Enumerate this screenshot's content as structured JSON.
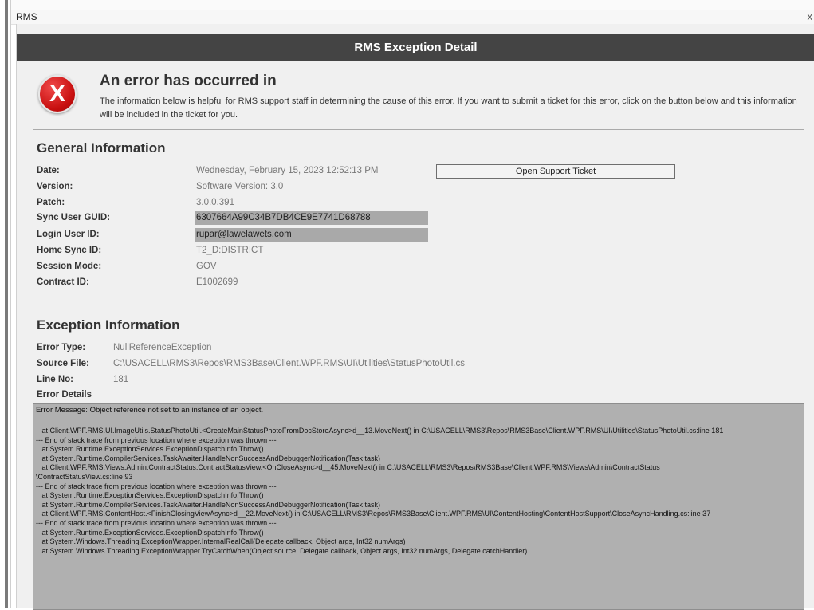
{
  "window": {
    "title": "RMS",
    "close_glyph": "x"
  },
  "dialog": {
    "header": "RMS Exception Detail",
    "error_icon_glyph": "X",
    "error_title": "An error has occurred in",
    "error_description": "The information below is helpful for RMS support staff in determining the cause of this error. If you want to submit a ticket for this error, click on the button below and this information will be included in the ticket for you.",
    "accent_colors": {
      "header_bg": "#444444",
      "error_red": "#c80f0f",
      "highlight_bg": "#a9a9a9"
    }
  },
  "general": {
    "title": "General Information",
    "open_ticket_label": "Open Support Ticket",
    "rows": [
      {
        "label": "Date:",
        "value": "Wednesday, February 15, 2023 12:52:13 PM"
      },
      {
        "label": "Version:",
        "value": "Software Version: 3.0"
      },
      {
        "label": "Patch:",
        "value": "3.0.0.391"
      },
      {
        "label": "Sync User GUID:",
        "value": "6307664A99C34B7DB4CE9E7741D68788"
      },
      {
        "label": "Login User ID:",
        "value": "rupar@lawelawets.com"
      },
      {
        "label": "Home Sync ID:",
        "value": "T2_D:DISTRICT"
      },
      {
        "label": "Session Mode:",
        "value": "GOV"
      },
      {
        "label": "Contract ID:",
        "value": "E1002699"
      }
    ]
  },
  "exception": {
    "title": "Exception Information",
    "rows": [
      {
        "label": "Error Type:",
        "value": "NullReferenceException"
      },
      {
        "label": "Source File:",
        "value": "C:\\USACELL\\RMS3\\Repos\\RMS3Base\\Client.WPF.RMS\\UI\\Utilities\\StatusPhotoUtil.cs"
      },
      {
        "label": "Line No:",
        "value": "181"
      }
    ],
    "details_label": "Error Details",
    "error_message": "Error Message: Object reference not set to an instance of an object.",
    "stack_trace": "   at Client.WPF.RMS.UI.ImageUtils.StatusPhotoUtil.<CreateMainStatusPhotoFromDocStoreAsync>d__13.MoveNext() in C:\\USACELL\\RMS3\\Repos\\RMS3Base\\Client.WPF.RMS\\UI\\Utilities\\StatusPhotoUtil.cs:line 181\n--- End of stack trace from previous location where exception was thrown ---\n   at System.Runtime.ExceptionServices.ExceptionDispatchInfo.Throw()\n   at System.Runtime.CompilerServices.TaskAwaiter.HandleNonSuccessAndDebuggerNotification(Task task)\n   at Client.WPF.RMS.Views.Admin.ContractStatus.ContractStatusView.<OnCloseAsync>d__45.MoveNext() in C:\\USACELL\\RMS3\\Repos\\RMS3Base\\Client.WPF.RMS\\Views\\Admin\\ContractStatus\n\\ContractStatusView.cs:line 93\n--- End of stack trace from previous location where exception was thrown ---\n   at System.Runtime.ExceptionServices.ExceptionDispatchInfo.Throw()\n   at System.Runtime.CompilerServices.TaskAwaiter.HandleNonSuccessAndDebuggerNotification(Task task)\n   at Client.WPF.RMS.ContentHost.<FinishClosingViewAsync>d__22.MoveNext() in C:\\USACELL\\RMS3\\Repos\\RMS3Base\\Client.WPF.RMS\\UI\\ContentHosting\\ContentHostSupport\\CloseAsyncHandling.cs:line 37\n--- End of stack trace from previous location where exception was thrown ---\n   at System.Runtime.ExceptionServices.ExceptionDispatchInfo.Throw()\n   at System.Windows.Threading.ExceptionWrapper.InternalRealCall(Delegate callback, Object args, Int32 numArgs)\n   at System.Windows.Threading.ExceptionWrapper.TryCatchWhen(Object source, Delegate callback, Object args, Int32 numArgs, Delegate catchHandler)"
  }
}
